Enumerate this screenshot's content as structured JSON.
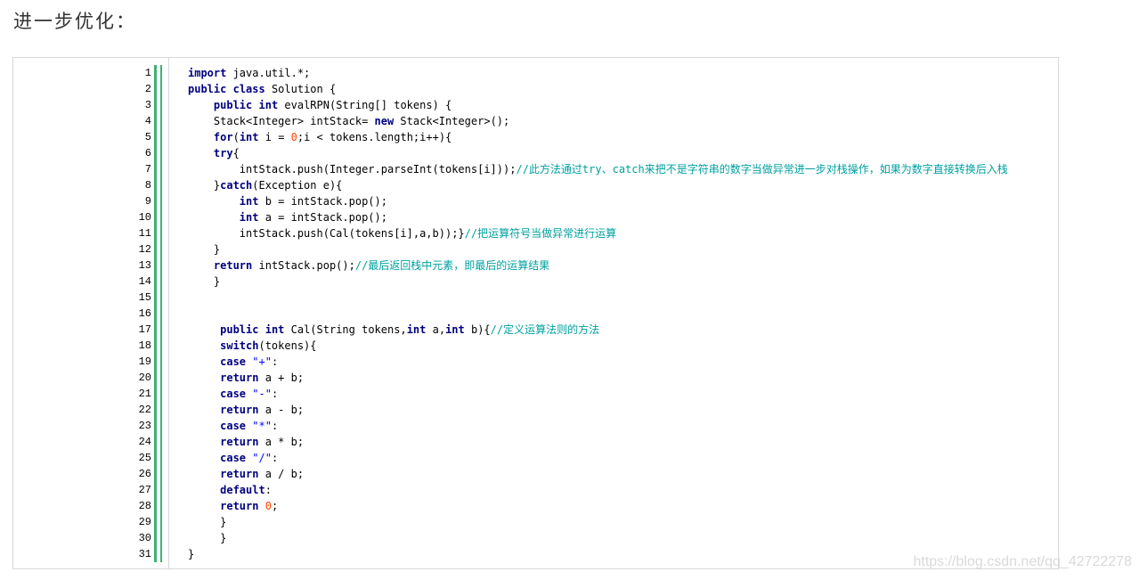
{
  "heading": "进一步优化：",
  "watermark": "https://blog.csdn.net/qq_42722278",
  "code_lines": [
    [
      {
        "t": "kw",
        "v": "import"
      },
      {
        "t": "",
        "v": " java.util.*;"
      }
    ],
    [
      {
        "t": "kw",
        "v": "public"
      },
      {
        "t": "",
        "v": " "
      },
      {
        "t": "kw",
        "v": "class"
      },
      {
        "t": "",
        "v": " Solution {"
      }
    ],
    [
      {
        "t": "",
        "v": "    "
      },
      {
        "t": "kw",
        "v": "public"
      },
      {
        "t": "",
        "v": " "
      },
      {
        "t": "kw",
        "v": "int"
      },
      {
        "t": "",
        "v": " evalRPN(String[] tokens) {"
      }
    ],
    [
      {
        "t": "",
        "v": "    Stack<Integer> intStack= "
      },
      {
        "t": "kw",
        "v": "new"
      },
      {
        "t": "",
        "v": " Stack<Integer>();"
      }
    ],
    [
      {
        "t": "",
        "v": "    "
      },
      {
        "t": "kw",
        "v": "for"
      },
      {
        "t": "",
        "v": "("
      },
      {
        "t": "kw",
        "v": "int"
      },
      {
        "t": "",
        "v": " i = "
      },
      {
        "t": "nm",
        "v": "0"
      },
      {
        "t": "",
        "v": ";i < tokens.length;i++){"
      }
    ],
    [
      {
        "t": "",
        "v": "    "
      },
      {
        "t": "kw",
        "v": "try"
      },
      {
        "t": "",
        "v": "{"
      }
    ],
    [
      {
        "t": "",
        "v": "        intStack.push(Integer.parseInt(tokens[i]));"
      },
      {
        "t": "cm",
        "v": "//此方法通过try、catch来把不是字符串的数字当做异常进一步对栈操作，如果为数字直接转换后入栈"
      }
    ],
    [
      {
        "t": "",
        "v": "    }"
      },
      {
        "t": "kw",
        "v": "catch"
      },
      {
        "t": "",
        "v": "(Exception e){"
      }
    ],
    [
      {
        "t": "",
        "v": "        "
      },
      {
        "t": "kw",
        "v": "int"
      },
      {
        "t": "",
        "v": " b = intStack.pop();"
      }
    ],
    [
      {
        "t": "",
        "v": "        "
      },
      {
        "t": "kw",
        "v": "int"
      },
      {
        "t": "",
        "v": " a = intStack.pop();"
      }
    ],
    [
      {
        "t": "",
        "v": "        intStack.push(Cal(tokens[i],a,b));}"
      },
      {
        "t": "cm",
        "v": "//把运算符号当做异常进行运算"
      }
    ],
    [
      {
        "t": "",
        "v": "    }"
      }
    ],
    [
      {
        "t": "",
        "v": "    "
      },
      {
        "t": "kw",
        "v": "return"
      },
      {
        "t": "",
        "v": " intStack.pop();"
      },
      {
        "t": "cm",
        "v": "//最后返回栈中元素，即最后的运算结果"
      }
    ],
    [
      {
        "t": "",
        "v": "    }"
      }
    ],
    [],
    [],
    [
      {
        "t": "",
        "v": "     "
      },
      {
        "t": "kw",
        "v": "public"
      },
      {
        "t": "",
        "v": " "
      },
      {
        "t": "kw",
        "v": "int"
      },
      {
        "t": "",
        "v": " Cal(String tokens,"
      },
      {
        "t": "kw",
        "v": "int"
      },
      {
        "t": "",
        "v": " a,"
      },
      {
        "t": "kw",
        "v": "int"
      },
      {
        "t": "",
        "v": " b){"
      },
      {
        "t": "cm",
        "v": "//定义运算法则的方法"
      }
    ],
    [
      {
        "t": "",
        "v": "     "
      },
      {
        "t": "kw",
        "v": "switch"
      },
      {
        "t": "",
        "v": "(tokens){"
      }
    ],
    [
      {
        "t": "",
        "v": "     "
      },
      {
        "t": "kw",
        "v": "case"
      },
      {
        "t": "",
        "v": " "
      },
      {
        "t": "st",
        "v": "\"+\""
      },
      {
        "t": "",
        "v": ":"
      }
    ],
    [
      {
        "t": "",
        "v": "     "
      },
      {
        "t": "kw",
        "v": "return"
      },
      {
        "t": "",
        "v": " a + b;"
      }
    ],
    [
      {
        "t": "",
        "v": "     "
      },
      {
        "t": "kw",
        "v": "case"
      },
      {
        "t": "",
        "v": " "
      },
      {
        "t": "st",
        "v": "\"-\""
      },
      {
        "t": "",
        "v": ":"
      }
    ],
    [
      {
        "t": "",
        "v": "     "
      },
      {
        "t": "kw",
        "v": "return"
      },
      {
        "t": "",
        "v": " a - b;"
      }
    ],
    [
      {
        "t": "",
        "v": "     "
      },
      {
        "t": "kw",
        "v": "case"
      },
      {
        "t": "",
        "v": " "
      },
      {
        "t": "st",
        "v": "\"*\""
      },
      {
        "t": "",
        "v": ":"
      }
    ],
    [
      {
        "t": "",
        "v": "     "
      },
      {
        "t": "kw",
        "v": "return"
      },
      {
        "t": "",
        "v": " a * b;"
      }
    ],
    [
      {
        "t": "",
        "v": "     "
      },
      {
        "t": "kw",
        "v": "case"
      },
      {
        "t": "",
        "v": " "
      },
      {
        "t": "st",
        "v": "\"/\""
      },
      {
        "t": "",
        "v": ":"
      }
    ],
    [
      {
        "t": "",
        "v": "     "
      },
      {
        "t": "kw",
        "v": "return"
      },
      {
        "t": "",
        "v": " a / b;"
      }
    ],
    [
      {
        "t": "",
        "v": "     "
      },
      {
        "t": "kw",
        "v": "default"
      },
      {
        "t": "",
        "v": ":"
      }
    ],
    [
      {
        "t": "",
        "v": "     "
      },
      {
        "t": "kw",
        "v": "return"
      },
      {
        "t": "",
        "v": " "
      },
      {
        "t": "nm",
        "v": "0"
      },
      {
        "t": "",
        "v": ";"
      }
    ],
    [
      {
        "t": "",
        "v": "     }"
      }
    ],
    [
      {
        "t": "",
        "v": "     }"
      }
    ],
    [
      {
        "t": "",
        "v": "}"
      }
    ]
  ],
  "colors": {
    "keyword": "#000080",
    "comment": "#00a0a0",
    "number": "#ff4500",
    "string": "#0000ff",
    "gutter_bar": "#3cb371"
  }
}
